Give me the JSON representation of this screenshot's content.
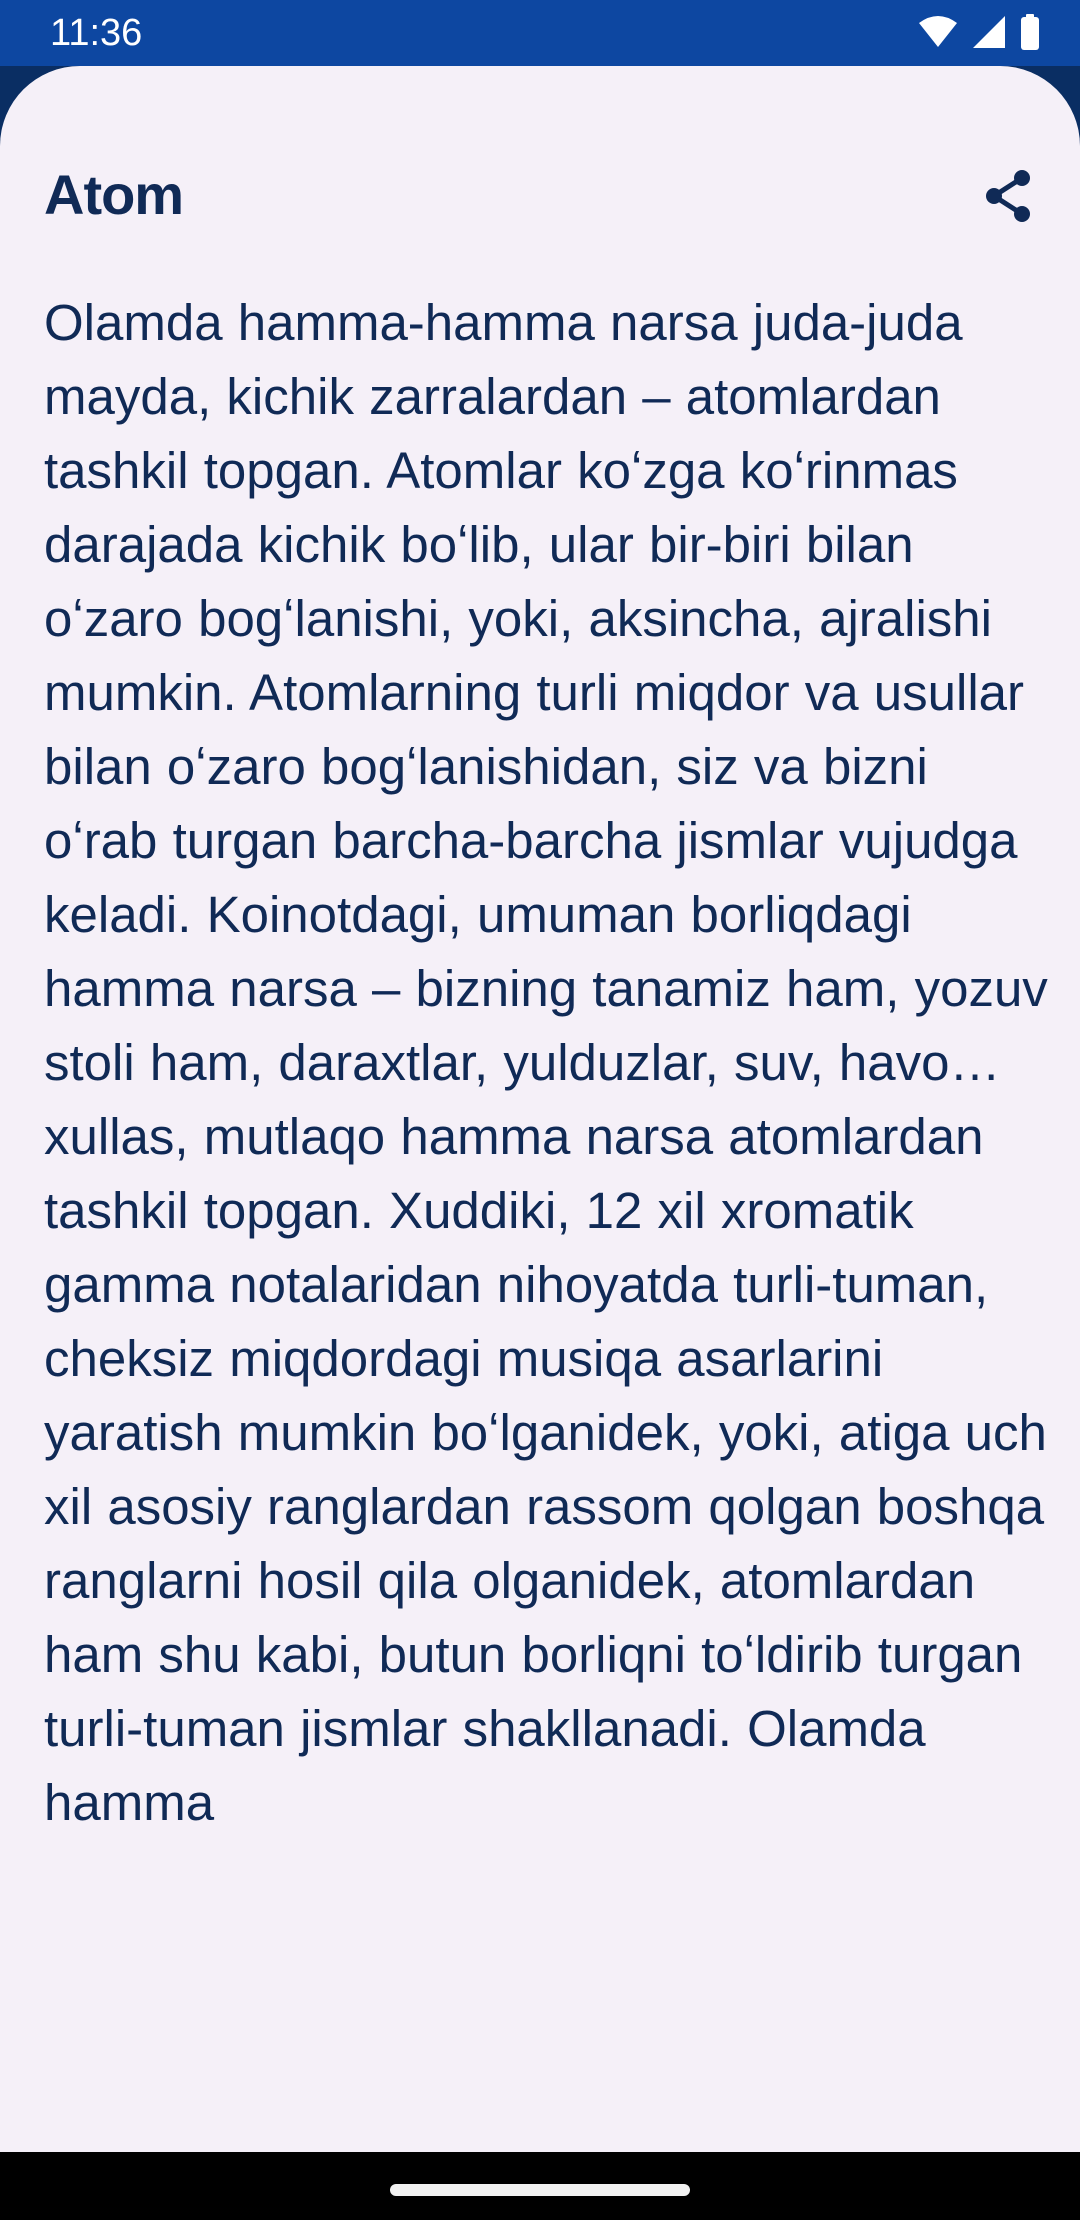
{
  "status_bar": {
    "time": "11:36",
    "icons": [
      "wifi-icon",
      "signal-icon",
      "battery-icon"
    ]
  },
  "article": {
    "title": "Atom",
    "share_icon": "share-icon",
    "body": "Olamda hamma-hamma narsa juda-juda mayda, kichik zarralardan – atomlardan tashkil topgan. Atomlar koʻzga koʻrinmas darajada kichik boʻlib, ular bir-biri bilan oʻzaro bogʻlanishi, yoki, aksincha, ajralishi mumkin. Atomlarning turli miqdor va usullar bilan oʻzaro bogʻlanishidan, siz va bizni oʻrab turgan barcha-barcha jismlar vujudga keladi. Koinotdagi, umuman borliqdagi hamma narsa – bizning tanamiz ham, yozuv stoli ham, daraxtlar, yulduzlar, suv, havo… xullas, mutlaqo hamma narsa atomlardan tashkil topgan. Xuddiki, 12 xil xromatik gamma notalaridan nihoyatda turli-tuman, cheksiz miqdordagi musiqa asarlarini yaratish mumkin boʻlganidek, yoki, atiga uch xil asosiy ranglardan rassom qolgan boshqa ranglarni hosil qila olganidek, atomlardan ham shu kabi, butun borliqni toʻldirib turgan turli-tuman jismlar shakllanadi. Olamda hamma"
  },
  "colors": {
    "status_bar": "#0d47a1",
    "sheet": "#f5f0f8",
    "text": "#102a56"
  }
}
